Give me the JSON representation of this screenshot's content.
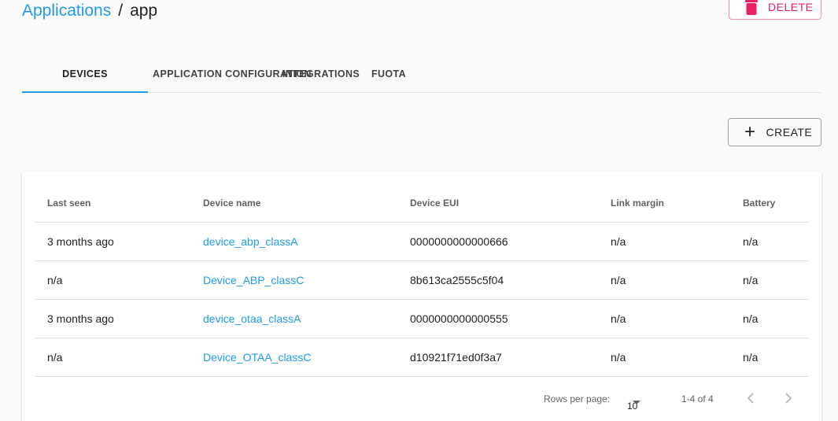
{
  "breadcrumb": {
    "parent": "Applications",
    "separator": "/",
    "current": "app"
  },
  "actions": {
    "delete_label": "DELETE",
    "create_label": "CREATE"
  },
  "tabs": [
    {
      "label": "DEVICES",
      "active": true
    },
    {
      "label": "APPLICATION CONFIGURATION",
      "active": false
    },
    {
      "label": "INTEGRATIONS",
      "active": false
    },
    {
      "label": "FUOTA",
      "active": false
    }
  ],
  "table": {
    "headers": [
      "Last seen",
      "Device name",
      "Device EUI",
      "Link margin",
      "Battery"
    ],
    "rows": [
      {
        "last_seen": "3 months ago",
        "name": "device_abp_classA",
        "eui": "0000000000000666",
        "link_margin": "n/a",
        "battery": "n/a"
      },
      {
        "last_seen": "n/a",
        "name": "Device_ABP_classC",
        "eui": "8b613ca2555c5f04",
        "link_margin": "n/a",
        "battery": "n/a"
      },
      {
        "last_seen": "3 months ago",
        "name": "device_otaa_classA",
        "eui": "0000000000000555",
        "link_margin": "n/a",
        "battery": "n/a"
      },
      {
        "last_seen": "n/a",
        "name": "Device_OTAA_classC",
        "eui": "d10921f71ed0f3a7",
        "link_margin": "n/a",
        "battery": "n/a"
      }
    ]
  },
  "pagination": {
    "rows_label": "Rows per page:",
    "rows_value": "10",
    "range": "1-4 of 4"
  },
  "colors": {
    "accent": "#1e9be9",
    "danger": "#e91e63"
  }
}
